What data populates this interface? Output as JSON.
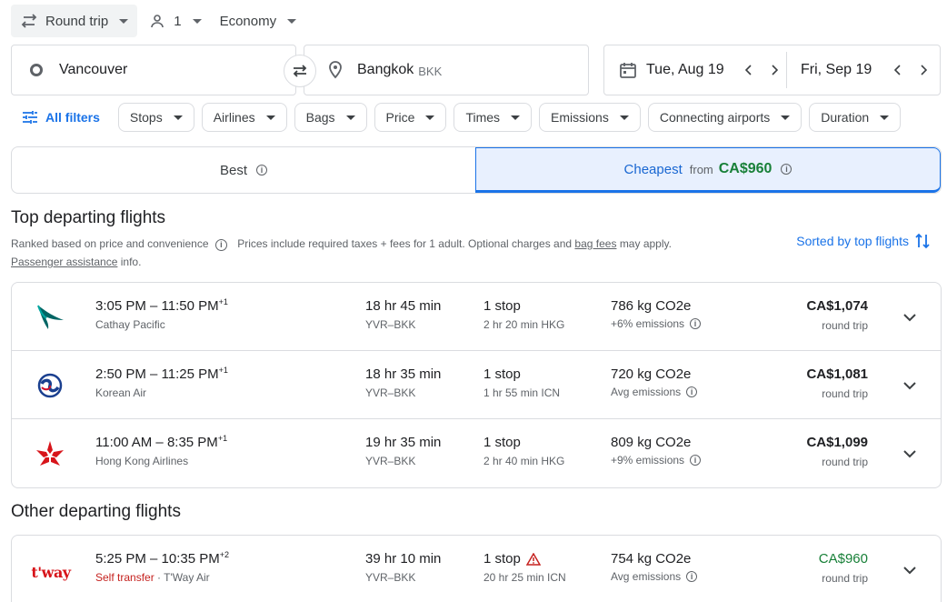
{
  "topbar": {
    "trip_type": "Round trip",
    "passengers": "1",
    "cabin": "Economy"
  },
  "search": {
    "origin": "Vancouver",
    "destination": "Bangkok",
    "destination_code": "BKK",
    "depart_date": "Tue, Aug 19",
    "return_date": "Fri, Sep 19"
  },
  "filters": {
    "all_filters": "All filters",
    "chips": [
      "Stops",
      "Airlines",
      "Bags",
      "Price",
      "Times",
      "Emissions",
      "Connecting airports",
      "Duration"
    ]
  },
  "sort_tabs": {
    "best": "Best",
    "cheapest": "Cheapest",
    "cheapest_from": "from",
    "cheapest_price": "CA$960"
  },
  "top_section": {
    "title": "Top departing flights",
    "ranked": "Ranked based on price and convenience",
    "prices_note_1": "Prices include required taxes + fees for 1 adult. Optional charges and",
    "bag_fees": "bag fees",
    "prices_note_2": "may apply.",
    "passenger_assistance": "Passenger assistance",
    "info_word": "info.",
    "sorted_by": "Sorted by top flights"
  },
  "other_section": {
    "title": "Other departing flights"
  },
  "flights": [
    {
      "times": "3:05 PM – 11:50 PM",
      "day_offset": "+1",
      "airline": "Cathay Pacific",
      "duration": "18 hr 45 min",
      "route": "YVR–BKK",
      "stops": "1 stop",
      "layover": "2 hr 20 min HKG",
      "co2": "786 kg CO2e",
      "emissions": "+6% emissions",
      "price": "CA$1,074",
      "price_type": "round trip",
      "logo": "cathay-logo"
    },
    {
      "times": "2:50 PM – 11:25 PM",
      "day_offset": "+1",
      "airline": "Korean Air",
      "duration": "18 hr 35 min",
      "route": "YVR–BKK",
      "stops": "1 stop",
      "layover": "1 hr 55 min ICN",
      "co2": "720 kg CO2e",
      "emissions": "Avg emissions",
      "price": "CA$1,081",
      "price_type": "round trip",
      "logo": "korean-air-logo"
    },
    {
      "times": "11:00 AM – 8:35 PM",
      "day_offset": "+1",
      "airline": "Hong Kong Airlines",
      "duration": "19 hr 35 min",
      "route": "YVR–BKK",
      "stops": "1 stop",
      "layover": "2 hr 40 min HKG",
      "co2": "809 kg CO2e",
      "emissions": "+9% emissions",
      "price": "CA$1,099",
      "price_type": "round trip",
      "logo": "hong-kong-airlines-logo"
    }
  ],
  "other_flights": [
    {
      "times": "5:25 PM – 10:35 PM",
      "day_offset": "+2",
      "self_transfer": "Self transfer",
      "airline_sep": " · ",
      "airline": "T'Way Air",
      "duration": "39 hr 10 min",
      "route": "YVR–BKK",
      "stops": "1 stop",
      "layover": "20 hr 25 min ICN",
      "co2": "754 kg CO2e",
      "emissions": "Avg emissions",
      "price": "CA$960",
      "price_type": "round trip",
      "logo_text": "t'way"
    }
  ],
  "colors": {
    "accent": "#1a73e8",
    "green_price": "#188038",
    "warning": "#c5221f"
  }
}
